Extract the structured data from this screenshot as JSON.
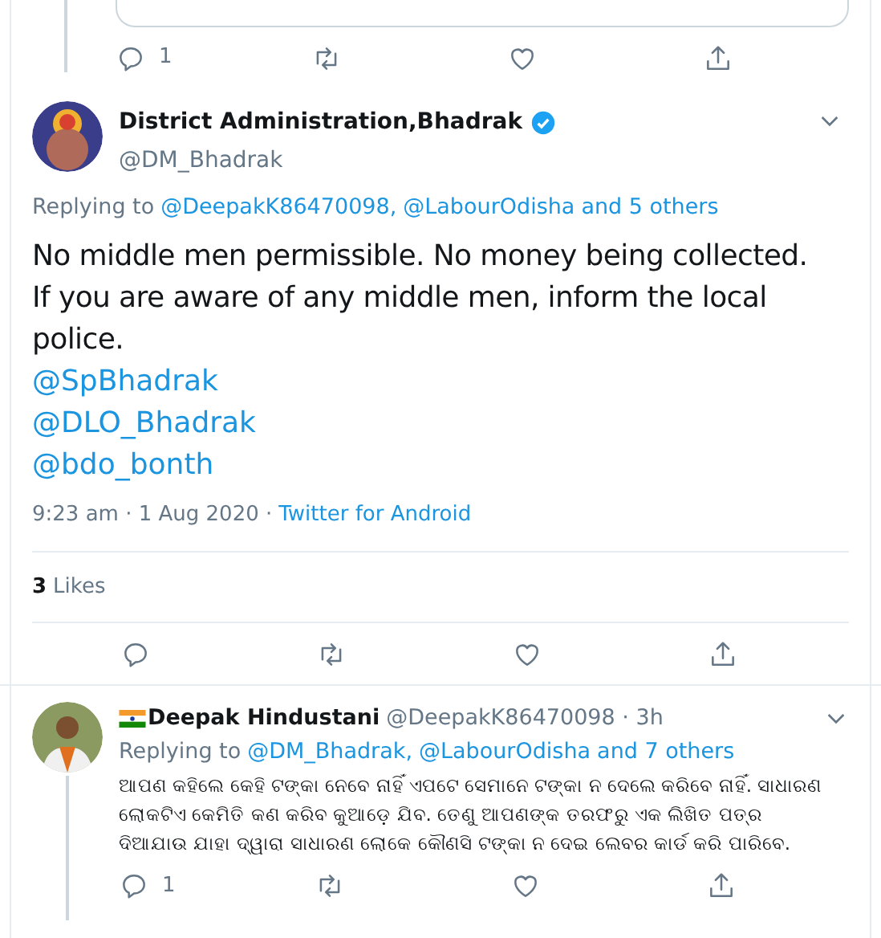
{
  "top_actions": {
    "reply_count": "1"
  },
  "tweet": {
    "name": "District Administration,Bhadrak",
    "verified": true,
    "handle": "@DM_Bhadrak",
    "replying_label": "Replying to",
    "replying_to": [
      "@DeepakK86470098,",
      "@LabourOdisha",
      "and 5 others"
    ],
    "lines": [
      "No middle men permissible. No money being collected. If you are aware of any middle men, inform the local police."
    ],
    "mentions": [
      "@SpBhadrak",
      "@DLO_Bhadrak",
      "@bdo_bonth"
    ],
    "time": "9:23 am · 1 Aug 2020 ·",
    "source": "Twitter for Android",
    "likes_count": "3",
    "likes_label": "Likes"
  },
  "reply": {
    "flag": true,
    "name": "Deepak Hindustani",
    "handle": "@DeepakK86470098 · 3h",
    "replying_label": "Replying to",
    "replying_to": [
      "@DM_Bhadrak,",
      "@LabourOdisha",
      "and 7 others"
    ],
    "text": "ଆପଣ କହିଲେ କେହି ଟଙ୍କା ନେବେ ନାହିଁ ଏପଟେ ସେମାନେ ଟଙ୍କା ନ ଦେଲେ କରିବେ ନାହିଁ. ସାଧାରଣ ଲୋକଟିଏ କେମିତି କଣ କରିବ କୁଆଡ଼େ ଯିବ. ତେଣୁ ଆପଣଙ୍କ ତରଫରୁ ଏକ ଲିଖିତ ପତ୍ର ଦିଆଯାଉ ଯାହା ଦ୍ୱାରା ସାଧାରଣ ଲୋକେ କୌଣସି ଟଙ୍କା ନ ଦେଇ ଲେବର କାର୍ଡ କରି ପାରିବେ.",
    "reply_count": "1"
  }
}
